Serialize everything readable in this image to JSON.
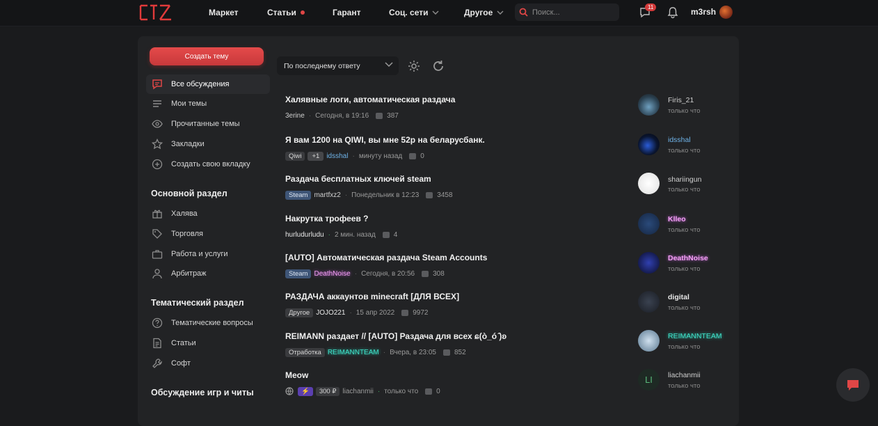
{
  "header": {
    "nav": [
      "Маркет",
      "Статьи",
      "Гарант",
      "Соц. сети",
      "Другое"
    ],
    "search_placeholder": "Поиск...",
    "notif_count": "11",
    "username": "m3rsh"
  },
  "sidebar": {
    "create_label": "Создать тему",
    "items": [
      {
        "label": "Все обсуждения",
        "icon": "chat-icon"
      },
      {
        "label": "Мои темы",
        "icon": "list-icon"
      },
      {
        "label": "Прочитанные темы",
        "icon": "eye-icon"
      },
      {
        "label": "Закладки",
        "icon": "star-icon"
      },
      {
        "label": "Создать свою вкладку",
        "icon": "plus-circle-icon"
      }
    ],
    "section1": "Основной раздел",
    "section1_items": [
      {
        "label": "Халява",
        "icon": "gift-icon"
      },
      {
        "label": "Торговля",
        "icon": "tag-icon"
      },
      {
        "label": "Работа и услуги",
        "icon": "briefcase-icon"
      },
      {
        "label": "Арбитраж",
        "icon": "user-icon"
      }
    ],
    "section2": "Тематический раздел",
    "section2_items": [
      {
        "label": "Тематические вопросы",
        "icon": "question-icon"
      },
      {
        "label": "Статьи",
        "icon": "document-icon"
      },
      {
        "label": "Софт",
        "icon": "wrench-icon"
      }
    ],
    "section3": "Обсуждение игр и читы"
  },
  "toolbar": {
    "sort_label": "По последнему ответу"
  },
  "threads": [
    {
      "title": "Халявные логи, автоматическая раздача",
      "author": "3erine",
      "time": "Сегодня, в 19:16",
      "replies": "387",
      "last_user": "Firis_21",
      "last_time": "только что"
    },
    {
      "title": "Я вам 1200 на QIWI, вы мне 52р на беларусбанк.",
      "tag": "Qiwi",
      "tag_extra": "+1",
      "author": "idsshal",
      "time": "минуту назад",
      "replies": "0",
      "last_user": "idsshal",
      "last_time": "только что"
    },
    {
      "title": "Раздача бесплатных ключей steam",
      "tag": "Steam",
      "author": "martfxz2",
      "time": "Понедельник в 12:23",
      "replies": "3458",
      "last_user": "shariingun",
      "last_time": "только что"
    },
    {
      "title": "Накрутка трофеев ?",
      "author": "hurludurludu",
      "time": "2 мин. назад",
      "replies": "4",
      "last_user": "Klleo",
      "last_time": "только что"
    },
    {
      "title": "[AUTO] Автоматическая раздача Steam Accounts",
      "tag": "Steam",
      "author": "DeathNoise",
      "time": "Сегодня, в 20:56",
      "replies": "308",
      "last_user": "DeathNoise",
      "last_time": "только что"
    },
    {
      "title": "РАЗДАЧА аккаунтов minecraft [ДЛЯ ВСЕХ]",
      "tag": "Другое",
      "author": "JOJO221",
      "time": "15 апр 2022",
      "replies": "9972",
      "last_user": "digital",
      "last_time": "только что"
    },
    {
      "title": "REIMANN раздает // [AUTO] Раздача для всех ɕ(ò_ó ̂)ʚ",
      "tag": "Отработка",
      "author": "REIMANNTEAM",
      "time": "Вчера, в 23:05",
      "replies": "852",
      "last_user": "REIMANNTEAM",
      "last_time": "только что"
    },
    {
      "title": "Meow",
      "price": "300 ₽",
      "author": "liachanmii",
      "time": "только что",
      "replies": "0",
      "last_user": "liachanmii",
      "last_time": "только что"
    }
  ],
  "colors": {
    "accent": "#e04646",
    "bg": "#1a1b1d",
    "panel": "#222325"
  }
}
